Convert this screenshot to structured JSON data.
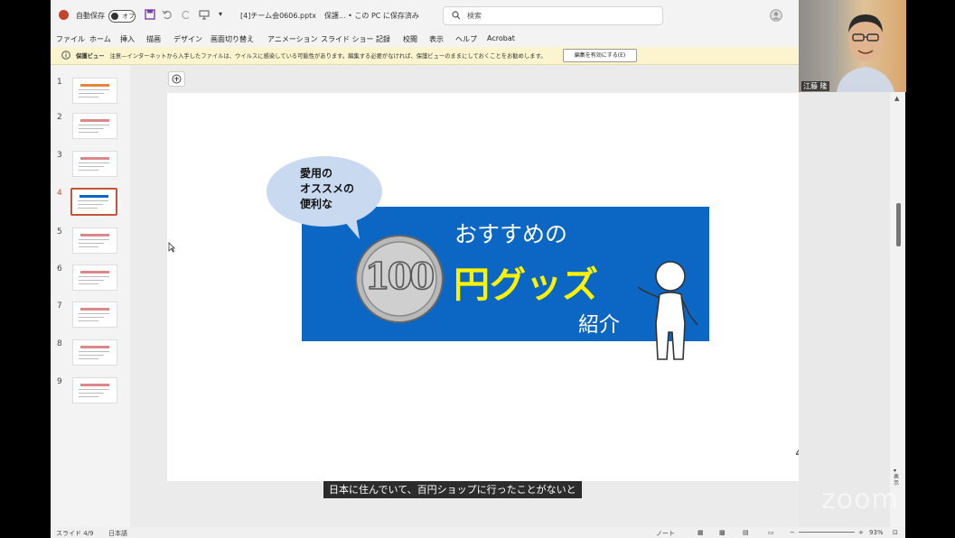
{
  "titlebar": {
    "autosave_label": "自動保存",
    "autosave_state": "オフ",
    "filename": "[4]チーム会0606.pptx",
    "doc_state": "保護... • この PC に保存済み",
    "search_placeholder": "検索"
  },
  "ribbon_tabs": [
    "ファイル",
    "ホーム",
    "挿入",
    "描画",
    "デザイン",
    "画面切り替え",
    "アニメーション",
    "スライド ショー",
    "記録",
    "校閲",
    "表示",
    "ヘルプ",
    "Acrobat"
  ],
  "protected_view": {
    "label": "保護ビュー",
    "message": "注意—インターネットから入手したファイルは、ウイルスに感染している可能性があります。編集する必要がなければ、保護ビューのままにしておくことをお勧めします。",
    "enable_button": "編集を有効にする(E)"
  },
  "thumbnails": [
    "1",
    "2",
    "3",
    "4",
    "5",
    "6",
    "7",
    "8",
    "9"
  ],
  "selected_slide": 4,
  "slide": {
    "bubble_text": "愛用の\nオススメの\n便利な",
    "title_line1": "おすすめの",
    "title_line2": "円グッズ",
    "title_line3": "紹介",
    "coin_text": "100",
    "page_number": "4",
    "banner_color": "#0b66c4",
    "highlight_color": "#fff200"
  },
  "caption": "日本に住んでいて、百円ショップに行ったことがないと",
  "video": {
    "participant_name": "江藤 隆"
  },
  "statusbar": {
    "slide_info": "スライド 4/9",
    "language": "日本語",
    "notes": "ノート",
    "zoom": "93%"
  },
  "side_label": "表示",
  "zoom_brand": "zoom"
}
